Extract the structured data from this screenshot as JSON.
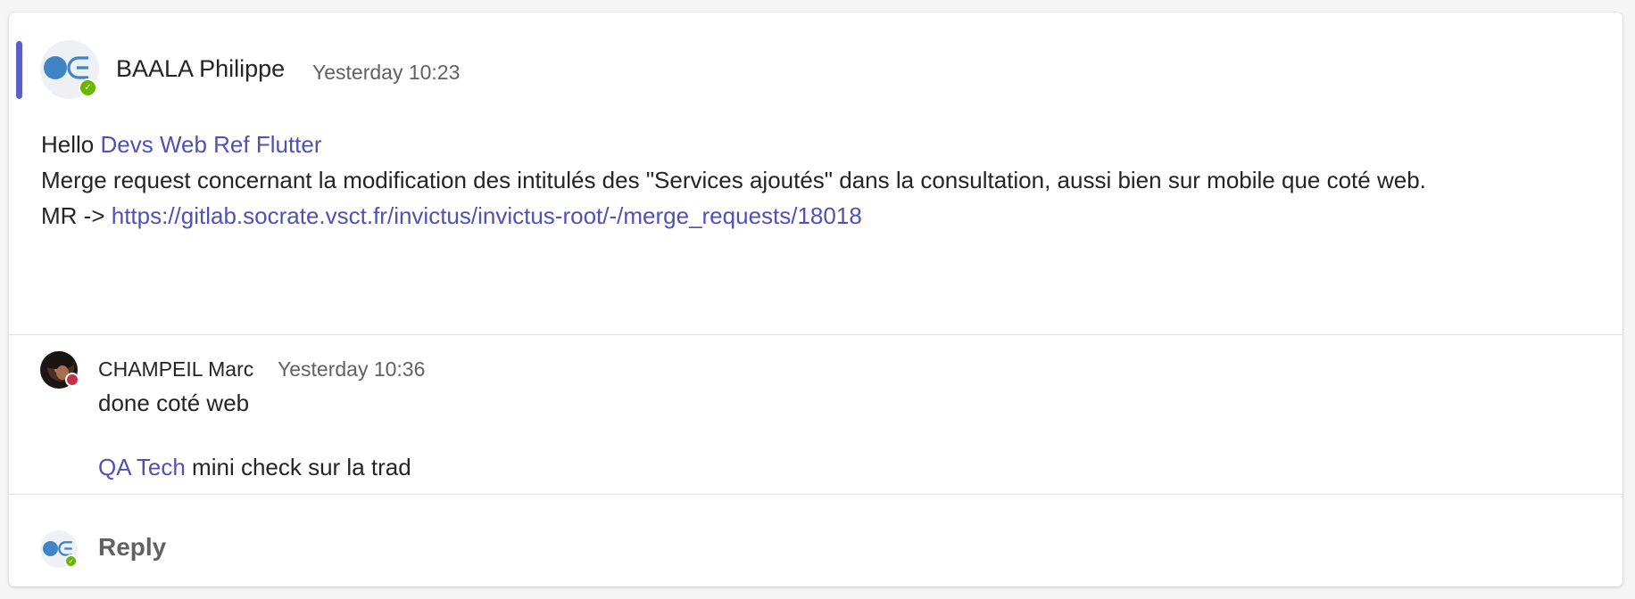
{
  "post": {
    "author": "BAALA Philippe",
    "timestamp": "Yesterday 10:23",
    "greeting": "Hello",
    "mention": "Devs Web Ref Flutter",
    "line2": "Merge request concernant la modification des intitulés des \"Services ajoutés\" dans la consultation, aussi bien sur mobile que coté web.",
    "mr_prefix": "MR ->",
    "mr_link": "https://gitlab.socrate.vsct.fr/invictus/invictus-root/-/merge_requests/18018",
    "presence": "available"
  },
  "replies": [
    {
      "author": "CHAMPEIL Marc",
      "timestamp": "Yesterday 10:36",
      "line1": "done coté web",
      "mention": "QA Tech",
      "line2_rest": "mini check sur la trad",
      "presence": "busy"
    }
  ],
  "compose": {
    "reply_label": "Reply"
  },
  "colors": {
    "accent": "#5b5fc7",
    "mention": "#4f52b2",
    "available": "#6bb700",
    "busy": "#c4314b"
  },
  "icons": {
    "checkmark": "check-icon"
  }
}
